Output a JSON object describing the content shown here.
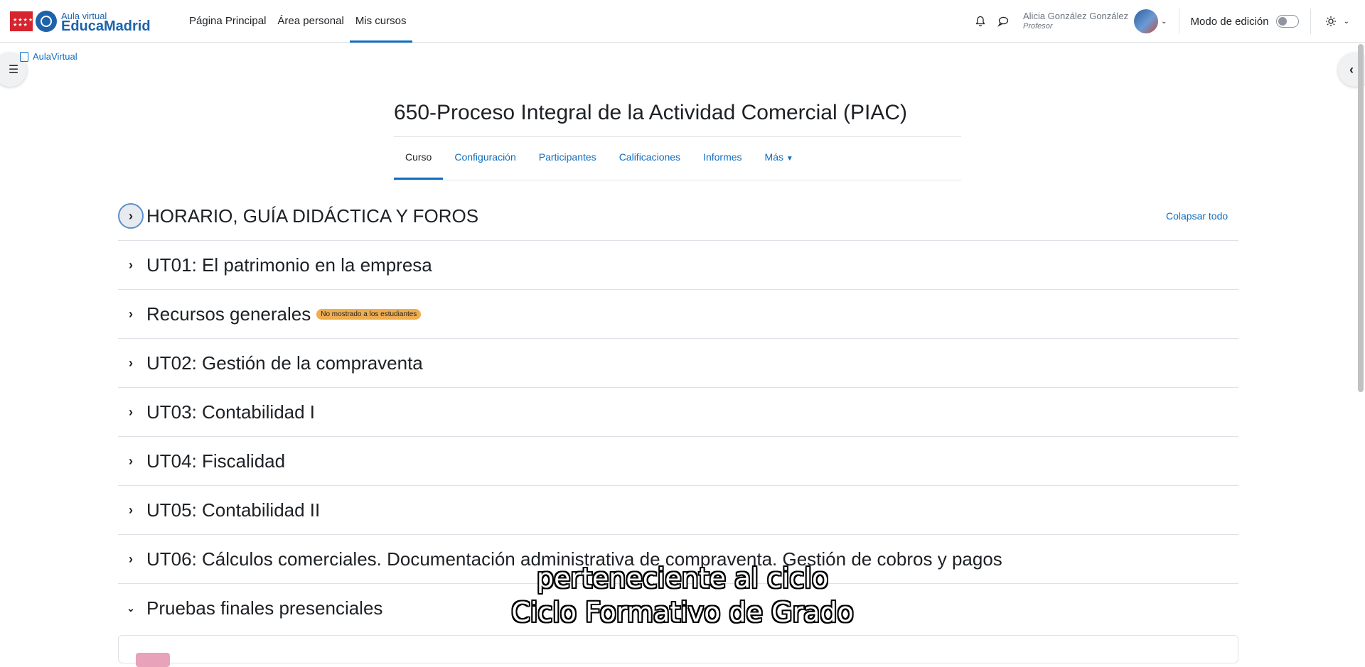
{
  "navbar": {
    "logo_small": "Aula virtual",
    "logo_big": "EducaMadrid",
    "links": [
      {
        "label": "Página Principal"
      },
      {
        "label": "Área personal"
      },
      {
        "label": "Mis cursos"
      }
    ],
    "active_link": "Mis cursos",
    "user_name": "Alicia González González",
    "user_role": "Profesor",
    "edit_mode_label": "Modo de edición",
    "edit_mode_on": false
  },
  "breadcrumb": {
    "label": "AulaVirtual"
  },
  "course": {
    "title": "650-Proceso Integral de la Actividad Comercial (PIAC)",
    "tabs": [
      {
        "label": "Curso"
      },
      {
        "label": "Configuración"
      },
      {
        "label": "Participantes"
      },
      {
        "label": "Calificaciones"
      },
      {
        "label": "Informes"
      },
      {
        "label": "Más"
      }
    ],
    "active_tab": "Curso",
    "collapse_all": "Colapsar todo"
  },
  "sections": [
    {
      "title": "HORARIO, GUÍA DIDÁCTICA Y FOROS",
      "expanded": false
    },
    {
      "title": "UT01: El patrimonio en la empresa",
      "expanded": false
    },
    {
      "title": "Recursos generales",
      "badge": "No mostrado a los estudiantes",
      "expanded": false
    },
    {
      "title": "UT02: Gestión de la compraventa",
      "expanded": false
    },
    {
      "title": "UT03: Contabilidad I",
      "expanded": false
    },
    {
      "title": "UT04: Fiscalidad",
      "expanded": false
    },
    {
      "title": "UT05: Contabilidad II",
      "expanded": false
    },
    {
      "title": "UT06: Cálculos comerciales. Documentación administrativa de compraventa. Gestión de cobros y pagos",
      "expanded": false
    },
    {
      "title": "Pruebas finales presenciales",
      "expanded": true
    }
  ],
  "subtitles": {
    "line1": "perteneciente al ciclo",
    "line2": "Ciclo Formativo de Grado"
  },
  "icons": {
    "notifications": "bell-icon",
    "messages": "chat-icon",
    "theme": "settings-icon",
    "left_drawer": "list-icon",
    "right_drawer": "chevron-left-icon"
  },
  "colors": {
    "accent": "#0f6cbf",
    "badge": "#f0ad4e",
    "logo_red": "#d8242d",
    "logo_blue": "#1d62ab"
  }
}
